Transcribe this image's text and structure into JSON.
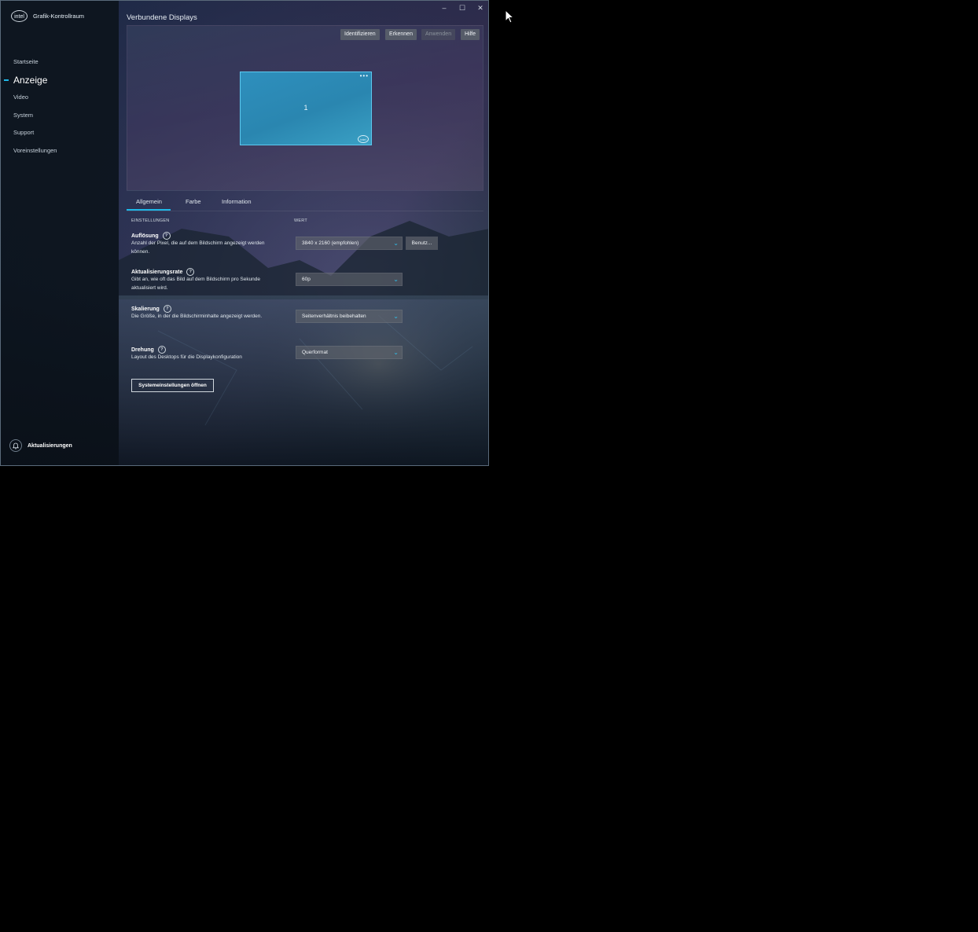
{
  "app": {
    "title": "Grafik-Kontrollraum",
    "logo_text": "intel"
  },
  "sidebar": {
    "items": [
      {
        "label": "Startseite"
      },
      {
        "label": "Anzeige"
      },
      {
        "label": "Video"
      },
      {
        "label": "System"
      },
      {
        "label": "Support"
      },
      {
        "label": "Voreinstellungen"
      }
    ],
    "active_item": "Anzeige",
    "updates_label": "Aktualisierungen"
  },
  "window_controls": {
    "minimize": "–",
    "maximize": "☐",
    "close": "✕"
  },
  "page": {
    "title": "Verbundene Displays"
  },
  "preview": {
    "buttons": {
      "identify": "Identifizieren",
      "detect": "Erkennen",
      "apply": "Anwenden",
      "help": "Hilfe"
    },
    "apply_enabled": false,
    "monitor": {
      "number": "1",
      "menu": "•••",
      "badge": "intel"
    }
  },
  "tabs": [
    {
      "label": "Allgemein",
      "active": true
    },
    {
      "label": "Farbe",
      "active": false
    },
    {
      "label": "Information",
      "active": false
    }
  ],
  "table": {
    "col_settings": "EINSTELLUNGEN",
    "col_value": "WERT"
  },
  "settings": {
    "resolution": {
      "title": "Auflösung",
      "desc": "Anzahl der Pixel, die auf dem Bildschirm angezeigt werden können.",
      "value": "3840 x 2160 (empfohlen)",
      "custom_label": "Benutz..."
    },
    "refresh": {
      "title": "Aktualisierungsrate",
      "desc": "Gibt an, wie oft das Bild auf dem Bildschirm pro Sekunde aktualisiert wird.",
      "value": "60p"
    },
    "scaling": {
      "title": "Skalierung",
      "desc": "Die Größe, in der die Bildschirminhalte angezeigt werden.",
      "value": "Seitenverhältnis beibehalten"
    },
    "rotation": {
      "title": "Drehung",
      "desc": "Layout des Desktops für die Displaykonfiguration",
      "value": "Querformat"
    }
  },
  "system_settings_button": "Systemeinstellungen öffnen",
  "colors": {
    "accent": "#1eb8e8",
    "monitor": "#2a86b0"
  }
}
